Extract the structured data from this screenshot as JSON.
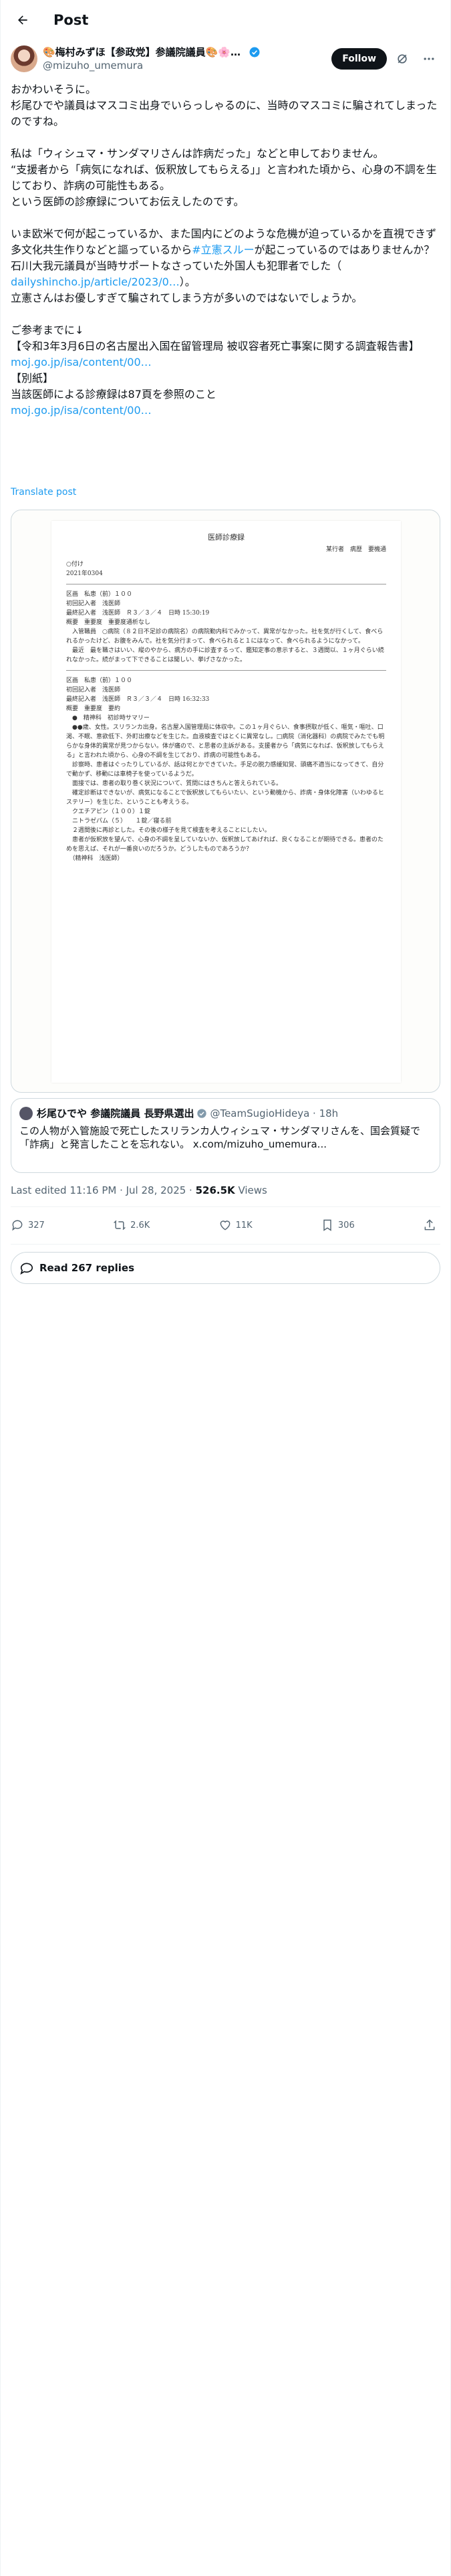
{
  "header": {
    "title": "Post"
  },
  "author": {
    "display_name": "🎨梅村みずほ【参政党】参議院議員🎨🌸日本人...",
    "handle": "@mizuho_umemura",
    "follow_label": "Follow"
  },
  "post": {
    "lines": [
      "おかわいそうに。",
      "杉尾ひでや議員はマスコミ出身でいらっしゃるのに、当時のマスコミに騙されてしまったのですね。",
      "",
      "私は「ウィシュマ・サンダマリさんは詐病だった」などと申しておりません。",
      "“支援者から「病気になれば、仮釈放してもらえる」」と言われた頃から、心身の不調を生じており、詐病の可能性もある。",
      "という医師の診療録についてお伝えしたのです。",
      "",
      "いま欧米で何が起こっているか、また国内にどのような危機が迫っているかを直視できず多文化共生作りなどと謳っているから",
      "#立憲スルー",
      "が起こっているのではありませんか？",
      "石川大我元議員が当時サポートなさっていた外国人も犯罪者でした（",
      "dailyshincho.jp/article/2023/0…",
      "）。",
      "立憲さんはお優しすぎて騙されてしまう方が多いのではないでしょうか。",
      "",
      "ご参考までに↓",
      "【令和3年3月6日の名古屋出入国在留管理局 被収容者死亡事案に関する調査報告書】",
      "moj.go.jp/isa/content/00…",
      "【別紙】",
      "当該医師による診療録は87頁を参照のこと",
      "moj.go.jp/isa/content/00…"
    ],
    "translate_label": "Translate post"
  },
  "document": {
    "title": "医師診療録",
    "header_right": "某行者　病歴　要機通",
    "blocks": [
      "○付け\n2021年0304",
      "区画　私患（前）１００\n初回記入者　浅医師\n最終記入者　浅医師　Ｒ３／３／４　日時 15:30:19\n概要　重要度　重要度通析なし\n　入管職員　○病院（８２日不足診の病院名）の病院勤内科でみかって、異常がなかった。社を気が行くして、食べられるかったけど、お腹をみんで。社を気分行まって、食べられると１にはなって、食べられるようになかって。\n　最近　最を職さはいい、縦のやから、病方の手に診査するって、鑑知定事の意示すると、３週間以、１ヶ月ぐらい続れなかった。続がまって下できることは聞しい、挙げさなかった。",
      "区画　私患（前）１００\n初回記入者　浅医師\n最終記入者　浅医師　Ｒ３／３／４　日時 16:32:33\n概要　重要度　要約\n　●　精神科　初診時サマリー\n　●●歳、女性。スリランカ出身。名古屋入国管理局に体収中。この１ヶ月ぐらい、食事摂取が低く、嘔気・嘔吐、口渇、不眠、意欲低下、外町出療などを生じた。血液検査ではとくに異常なし。□病院（消化器科）の病院でみたでも明らかな身体的異常が見つからない。体が痛ので、と思者の主訴がある。支援者から「病気になれば、仮釈放してもらえる」と言われた頃から、心身の不調を生じており、詐病の可能性もある。\n　診察時、患者はぐったりしているが、話は何とかできていた。手足の脱力感緩知覚、頭痛不適当になってきて、自分で動かず、移動には車椅子を使っているようだ。\n　面接では、患者の取り巻く状況について、質問にはきちんと答えられている。\n　確定診断はできないが、病気になることで仮釈放してもらいたい、という動機から、詐病・身体化障害（いわゆるヒステリー）を生じた、ということも考えうる。\n　クエチアピン（１００）１錠\n　ニトラゼパム（５）　　１錠／寝る前\n　２週間後に再診とした。その後の様子を見て検査を考えることにしたい。\n　患者が仮釈放を望んで、心身の不調を呈していないか、仮釈放してあげれば、良くなることが期待できる。患者のためを思えば、それが一番良いのだろうか。どうしたものであろうか？\n　（精神科　浅医師）"
    ]
  },
  "quote": {
    "name": "杉尾ひでや 参議院議員 長野県選出",
    "handle": "@TeamSugioHideya · 18h",
    "text": "この人物が入管施設で死亡したスリランカ人ウィシュマ・サンダマリさんを、国会質疑で「詐病」と発言したことを忘れない。 x.com/mizuho_umemura..."
  },
  "meta": {
    "time": "Last edited 11:16 PM · Jul 28, 2025 · ",
    "views_count": "526.5K",
    "views_label": " Views"
  },
  "actions": {
    "replies": "327",
    "reposts": "2.6K",
    "likes": "11K",
    "bookmarks": "306"
  },
  "read_replies": "Read 267 replies"
}
